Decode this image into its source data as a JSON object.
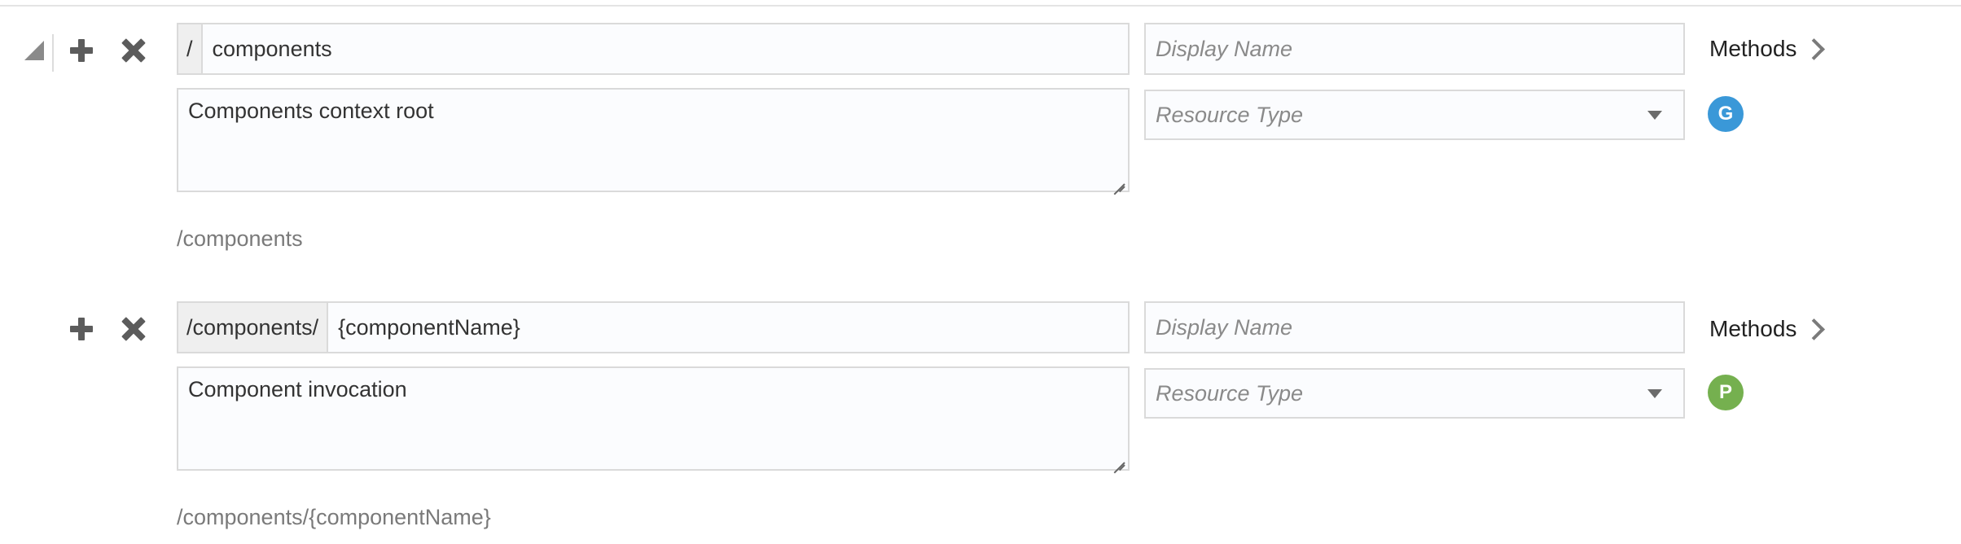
{
  "resources": [
    {
      "id": "components",
      "prefix": "/",
      "path": "components",
      "display_name": {
        "value": "",
        "placeholder": "Display Name"
      },
      "description": "Components context root",
      "resource_type": {
        "placeholder": "Resource Type"
      },
      "methods_label": "Methods",
      "method_badge": {
        "letter": "G",
        "color": "#3a98d8"
      },
      "full_path": "/components"
    },
    {
      "id": "component-name",
      "prefix": "/components/",
      "path": "{componentName}",
      "display_name": {
        "value": "",
        "placeholder": "Display Name"
      },
      "description": "Component invocation",
      "resource_type": {
        "placeholder": "Resource Type"
      },
      "methods_label": "Methods",
      "method_badge": {
        "letter": "P",
        "color": "#75b04f"
      },
      "full_path": "/components/{componentName}"
    }
  ]
}
